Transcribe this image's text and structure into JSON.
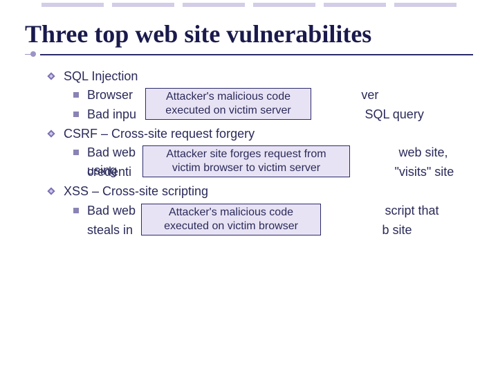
{
  "title": "Three top web site vulnerabilites",
  "sections": [
    {
      "heading": "SQL Injection",
      "items": [
        {
          "pre": "Browser",
          "post": "ver",
          "overlay": null
        },
        {
          "pre": "Bad inpu",
          "post": " SQL query",
          "overlay": null
        }
      ],
      "overlay": {
        "line1": "Attacker's malicious code",
        "line2": "executed on victim server"
      }
    },
    {
      "heading": "CSRF – Cross-site request forgery",
      "items": [
        {
          "pre": "Bad web",
          "post": "web site, using"
        },
        {
          "pre2": "credenti",
          "post2": " \"visits\" site"
        }
      ],
      "overlay": {
        "line1": "Attacker site forges request from",
        "line2": "victim browser to victim server"
      }
    },
    {
      "heading": "XSS – Cross-site scripting",
      "items": [
        {
          "pre": "Bad web",
          "post": "script that"
        },
        {
          "pre2": "steals in",
          "post2": "b site"
        }
      ],
      "overlay": {
        "line1": "Attacker's malicious code",
        "line2": "executed on victim browser"
      }
    }
  ]
}
